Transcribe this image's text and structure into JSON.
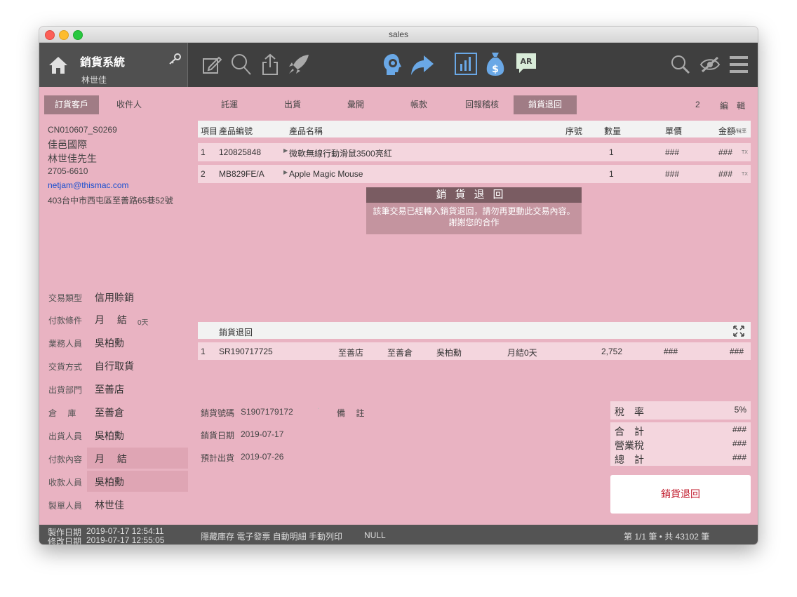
{
  "window": {
    "title": "sales"
  },
  "header": {
    "app_title": "銷貨系統",
    "user": "林世佳"
  },
  "toolbar_icons": [
    "home-icon",
    "key-icon",
    "compose-icon",
    "search-icon",
    "share-icon",
    "rocket-icon",
    "support-agent-icon",
    "forward-arrow-icon",
    "bar-chart-icon",
    "money-bag-icon",
    "ar-chat-icon",
    "search-icon",
    "hide-icon",
    "menu-icon"
  ],
  "left_tabs": {
    "customer": "訂貨客戶",
    "recipient": "收件人"
  },
  "customer": {
    "code": "CN010607_S0269",
    "company": "佳邑國際",
    "contact": "林世佳先生",
    "phone": "2705-6610",
    "email": "netjam@thismac.com",
    "address": "403台中市西屯區至善路65巷52號"
  },
  "fields": [
    {
      "label": "交易類型",
      "value": "信用賒銷"
    },
    {
      "label": "付款條件",
      "value": "月　 結",
      "suffix": "0天"
    },
    {
      "label": "業務人員",
      "value": "吳柏勳"
    },
    {
      "label": "交貨方式",
      "value": "自行取貨"
    },
    {
      "label": "出貨部門",
      "value": "至善店"
    },
    {
      "label": "倉　 庫",
      "value": "至善倉"
    },
    {
      "label": "出貨人員",
      "value": "吳柏勳"
    },
    {
      "label": "付款內容",
      "value": "月　 結"
    },
    {
      "label": "收款人員",
      "value": "吳柏勳"
    },
    {
      "label": "製單人員",
      "value": "林世佳"
    }
  ],
  "tabs": [
    "託運",
    "出貨",
    "彙開",
    "帳款",
    "回報稽核",
    "銷貨退回"
  ],
  "tabs_active": "銷貨退回",
  "page_count": "2",
  "edit_label": "編　輯",
  "table": {
    "headers": {
      "item": "項目",
      "code": "產品編號",
      "name": "產品名稱",
      "serial": "序號",
      "qty": "數量",
      "price": "單價",
      "amount": "金額",
      "amount_sub": "/稅率"
    },
    "rows": [
      {
        "item": "1",
        "code": "120825848",
        "name": "微軟無線行動滑鼠3500亮紅",
        "qty": "1",
        "price": "###",
        "amount": "###",
        "tax": "TX"
      },
      {
        "item": "2",
        "code": "MB829FE/A",
        "name": "Apple Magic Mouse",
        "qty": "1",
        "price": "###",
        "amount": "###",
        "tax": "TX"
      }
    ]
  },
  "modal": {
    "title": "銷貨退回",
    "line1": "該筆交易已經轉入銷貨退回，請勿再更動此交易內容。",
    "line2": "謝謝您的合作"
  },
  "portal": {
    "title": "銷貨退回",
    "row": {
      "item": "1",
      "doc": "SR190717725",
      "store": "至善店",
      "warehouse": "至善倉",
      "staff": "吳柏勳",
      "terms": "月結0天",
      "qty": "2,752",
      "price": "###",
      "amount": "###"
    }
  },
  "sale_info": {
    "no_label": "銷貨號碼",
    "no_value": "S1907179172",
    "note_label": "備　 註",
    "date_label": "銷貨日期",
    "date_value": "2019-07-17",
    "ship_label": "預計出貨",
    "ship_value": "2019-07-26"
  },
  "totals": {
    "tax_rate_label": "稅　率",
    "tax_rate_value": "5%",
    "subtotal_label": "合　計",
    "subtotal_value": "###",
    "tax_label": "營業稅",
    "tax_value": "###",
    "total_label": "總　計",
    "total_value": "###"
  },
  "action_button": "銷貨退回",
  "status": {
    "created_label": "製作日期",
    "created_value": "2019-07-17  12:54:11",
    "modified_label": "修改日期",
    "modified_value": "2019-07-17  12:55:05",
    "options": "隱藏庫存  電子發票  自動明細  手動列印",
    "null_text": "NULL",
    "record": "第 1/1 筆 • 共 43102 筆"
  }
}
